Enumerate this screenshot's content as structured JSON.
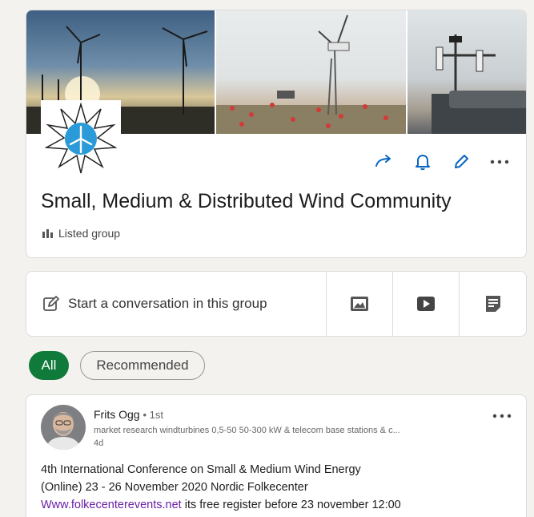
{
  "group": {
    "title": "Small, Medium & Distributed Wind Community",
    "type_label": "Listed group",
    "icons": {
      "share": "share-arrow-icon",
      "notifications": "bell-icon",
      "edit": "pencil-icon",
      "more": "more-horizontal-icon",
      "type": "group-visibility-icon",
      "logo": "wind-turbine-sun-logo"
    }
  },
  "composer": {
    "start_label": "Start a conversation in this group",
    "icons": [
      "compose-pencil-icon",
      "photo-icon",
      "video-icon",
      "document-icon"
    ]
  },
  "filters": {
    "all_label": "All",
    "recommended_label": "Recommended"
  },
  "post": {
    "author": "Frits Ogg",
    "degree": "• 1st",
    "headline": "market research windturbines 0,5-50 50-300 kW & telecom base stations & c...",
    "time": "4d",
    "line1": "4th International Conference on Small & Medium Wind Energy",
    "line2": "(Online) 23 - 26 November 2020 Nordic Folkecenter",
    "link_text": "Www.folkecenterevents.net",
    "line3_rest": " its free register before 23 november 12:00"
  },
  "colors": {
    "accent_blue": "#0a66c2",
    "active_green": "#0f7a3a",
    "link_purple": "#6a1fa6",
    "background": "#f3f2ef"
  }
}
